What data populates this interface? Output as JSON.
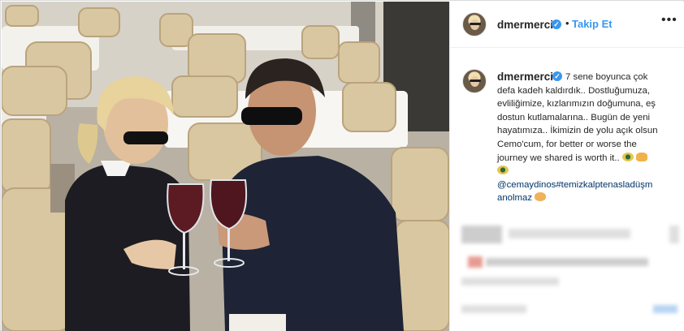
{
  "post": {
    "username": "dmermerci",
    "follow_label": "Takip Et",
    "dot": "•",
    "more_label": "•••",
    "verified_mark": "✓"
  },
  "caption": {
    "username": "dmermerci",
    "lines": [
      "7 sene boyunca çok",
      "defa kadeh kaldırdık.. Dostluğumuza,",
      "evliliğimize, kızlarımızın doğumuna, eş",
      "dostun kutlamalarına.. Bugün de yeni",
      "hayatımıza.. İkimizin de yolu açık olsun",
      "Cemo'cum, for better or worse the",
      "journey we shared is worth it.."
    ],
    "mention_line1": "@cemaydinos",
    "hashtag_line1": "#temizkalptenasladüşm",
    "hashtag_line2": "anolmaz"
  },
  "icons": {
    "avatar": "avatar",
    "verified": "verified-badge-icon",
    "more": "more-options-icon"
  },
  "colors": {
    "link_blue": "#3897f0",
    "text": "#262626",
    "border": "#dbdbdb"
  }
}
